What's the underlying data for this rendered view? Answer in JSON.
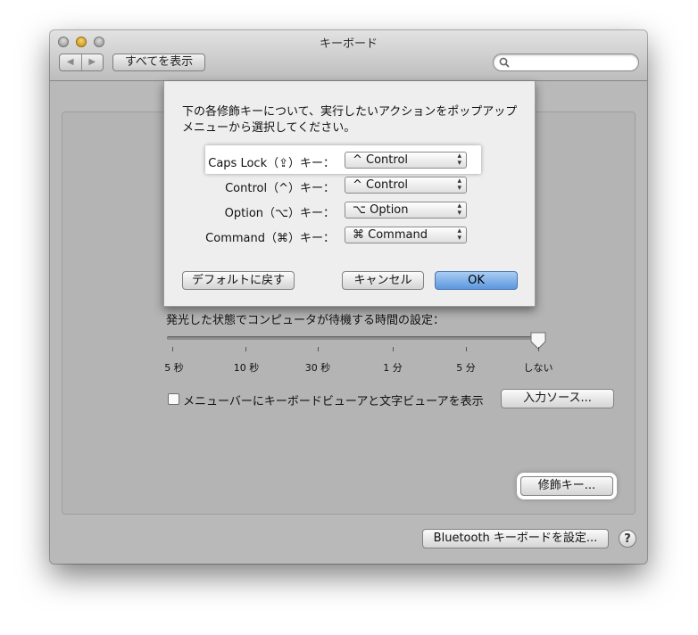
{
  "window": {
    "title": "キーボード",
    "nav_back": "◀",
    "nav_forward": "▶",
    "show_all": "すべてを表示",
    "search_placeholder": ""
  },
  "sheet": {
    "instructions": "下の各修飾キーについて、実行したいアクションをポップアップメニューから選択してください。",
    "rows": [
      {
        "label": "Caps Lock（⇪）キー：",
        "value": "^ Control"
      },
      {
        "label": "Control（^）キー：",
        "value": "^ Control"
      },
      {
        "label": "Option（⌥）キー：",
        "value": "⌥ Option"
      },
      {
        "label": "Command（⌘）キー：",
        "value": "⌘ Command"
      }
    ],
    "default_button": "デフォルトに戻す",
    "cancel_button": "キャンセル",
    "ok_button": "OK"
  },
  "main": {
    "slider_label": "発光した状態でコンピュータが待機する時間の設定：",
    "slider_ticks": [
      "5 秒",
      "10 秒",
      "30 秒",
      "1 分",
      "5 分",
      "しない"
    ],
    "slider_selected": "しない",
    "checkbox_label": "メニューバーにキーボードビューアと文字ビューアを表示",
    "checkbox_checked": false,
    "input_sources_button": "入力ソース...",
    "modifier_keys_button": "修飾キー...",
    "bluetooth_button": "Bluetooth キーボードを設定...",
    "help_button": "?"
  },
  "colors": {
    "window_bg": "#b9b9b9",
    "sheet_bg": "#eeeeee",
    "ok_button": "#5d97dd"
  }
}
